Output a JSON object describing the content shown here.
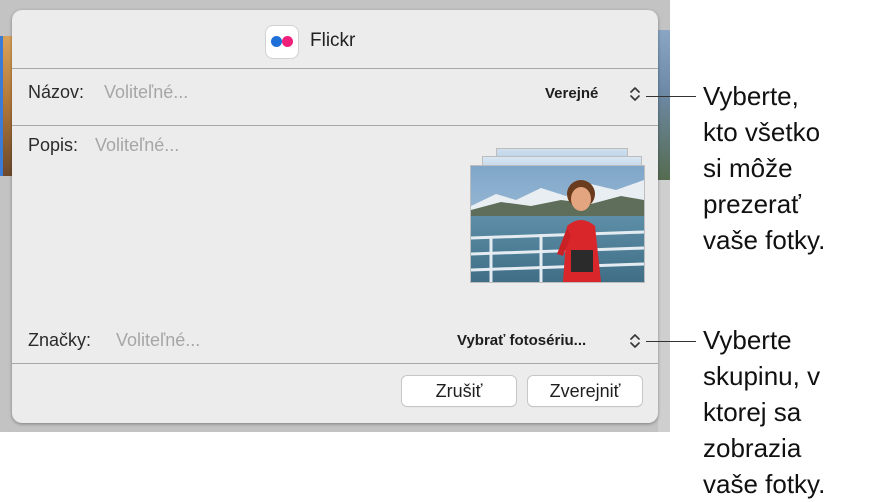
{
  "dialog": {
    "app_name": "Flickr",
    "app_icon": "flickr-logo-icon",
    "title_field": {
      "label": "Názov:",
      "placeholder": "Voliteľné..."
    },
    "privacy_popup": {
      "value": "Verejné",
      "icon": "chevron-updown-icon"
    },
    "description_field": {
      "label": "Popis:",
      "placeholder": "Voliteľné..."
    },
    "tags_field": {
      "label": "Značky:",
      "placeholder": "Voliteľné..."
    },
    "album_popup": {
      "value": "Vybrať fotosériu...",
      "icon": "chevron-updown-icon"
    },
    "buttons": {
      "cancel": "Zrušiť",
      "publish": "Zverejniť"
    }
  },
  "callouts": {
    "privacy": [
      "Vyberte,",
      "kto všetko",
      "si môže",
      "prezerať",
      "vaše fotky."
    ],
    "album": [
      "Vyberte",
      "skupinu, v",
      "ktorej sa",
      "zobrazia",
      "vaše fotky."
    ]
  },
  "colors": {
    "flickr_blue": "#1f6fd8",
    "flickr_pink": "#f0207a",
    "sheet_bg": "#ececec"
  }
}
